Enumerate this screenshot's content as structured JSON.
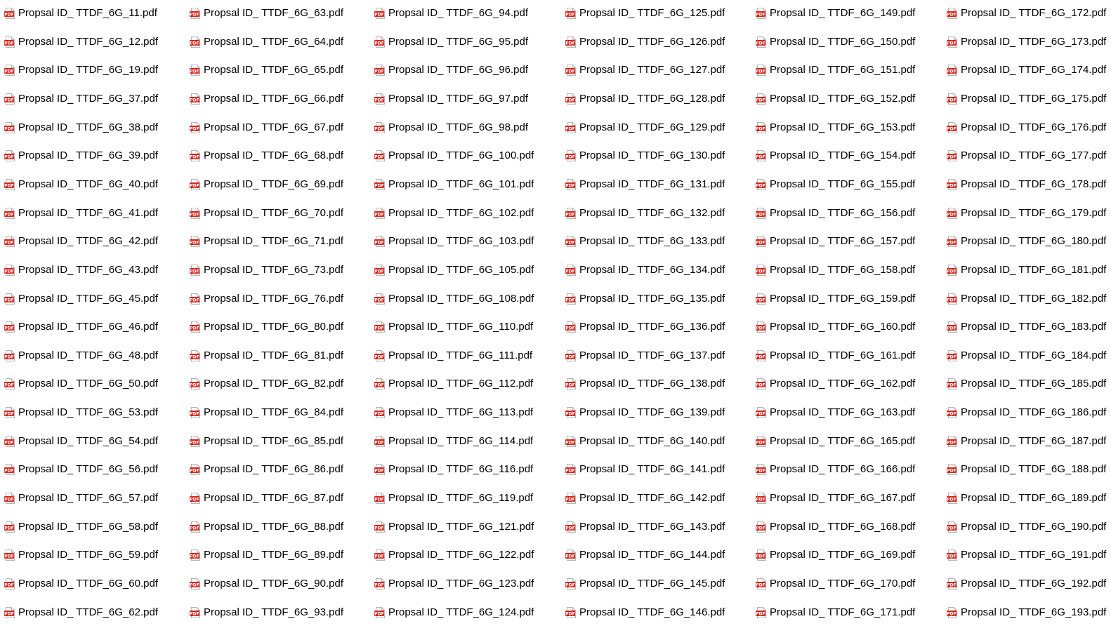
{
  "icon": "pdf-file-icon",
  "icon_colors": {
    "badge": "#d9261c",
    "page": "#ffffff",
    "border": "#b5b5b5"
  },
  "icon_badge_text": "PDF",
  "columns": [
    {
      "files": [
        "Propsal ID_ TTDF_6G_11.pdf",
        "Propsal ID_ TTDF_6G_12.pdf",
        "Propsal ID_ TTDF_6G_19.pdf",
        "Propsal ID_ TTDF_6G_37.pdf",
        "Propsal ID_ TTDF_6G_38.pdf",
        "Propsal ID_ TTDF_6G_39.pdf",
        "Propsal ID_ TTDF_6G_40.pdf",
        "Propsal ID_ TTDF_6G_41.pdf",
        "Propsal ID_ TTDF_6G_42.pdf",
        "Propsal ID_ TTDF_6G_43.pdf",
        "Propsal ID_ TTDF_6G_45.pdf",
        "Propsal ID_ TTDF_6G_46.pdf",
        "Propsal ID_ TTDF_6G_48.pdf",
        "Propsal ID_ TTDF_6G_50.pdf",
        "Propsal ID_ TTDF_6G_53.pdf",
        "Propsal ID_ TTDF_6G_54.pdf",
        "Propsal ID_ TTDF_6G_56.pdf",
        "Propsal ID_ TTDF_6G_57.pdf",
        "Propsal ID_ TTDF_6G_58.pdf",
        "Propsal ID_ TTDF_6G_59.pdf",
        "Propsal ID_ TTDF_6G_60.pdf",
        "Propsal ID_ TTDF_6G_62.pdf"
      ]
    },
    {
      "files": [
        "Propsal ID_ TTDF_6G_63.pdf",
        "Propsal ID_ TTDF_6G_64.pdf",
        "Propsal ID_ TTDF_6G_65.pdf",
        "Propsal ID_ TTDF_6G_66.pdf",
        "Propsal ID_ TTDF_6G_67.pdf",
        "Propsal ID_ TTDF_6G_68.pdf",
        "Propsal ID_ TTDF_6G_69.pdf",
        "Propsal ID_ TTDF_6G_70.pdf",
        "Propsal ID_ TTDF_6G_71.pdf",
        "Propsal ID_ TTDF_6G_73.pdf",
        "Propsal ID_ TTDF_6G_76.pdf",
        "Propsal ID_ TTDF_6G_80.pdf",
        "Propsal ID_ TTDF_6G_81.pdf",
        "Propsal ID_ TTDF_6G_82.pdf",
        "Propsal ID_ TTDF_6G_84.pdf",
        "Propsal ID_ TTDF_6G_85.pdf",
        "Propsal ID_ TTDF_6G_86.pdf",
        "Propsal ID_ TTDF_6G_87.pdf",
        "Propsal ID_ TTDF_6G_88.pdf",
        "Propsal ID_ TTDF_6G_89.pdf",
        "Propsal ID_ TTDF_6G_90.pdf",
        "Propsal ID_ TTDF_6G_93.pdf"
      ]
    },
    {
      "files": [
        "Propsal ID_ TTDF_6G_94.pdf",
        "Propsal ID_ TTDF_6G_95.pdf",
        "Propsal ID_ TTDF_6G_96.pdf",
        "Propsal ID_ TTDF_6G_97.pdf",
        "Propsal ID_ TTDF_6G_98.pdf",
        "Propsal ID_ TTDF_6G_100.pdf",
        "Propsal ID_ TTDF_6G_101.pdf",
        "Propsal ID_ TTDF_6G_102.pdf",
        "Propsal ID_ TTDF_6G_103.pdf",
        "Propsal ID_ TTDF_6G_105.pdf",
        "Propsal ID_ TTDF_6G_108.pdf",
        "Propsal ID_ TTDF_6G_110.pdf",
        "Propsal ID_ TTDF_6G_111.pdf",
        "Propsal ID_ TTDF_6G_112.pdf",
        "Propsal ID_ TTDF_6G_113.pdf",
        "Propsal ID_ TTDF_6G_114.pdf",
        "Propsal ID_ TTDF_6G_116.pdf",
        "Propsal ID_ TTDF_6G_119.pdf",
        "Propsal ID_ TTDF_6G_121.pdf",
        "Propsal ID_ TTDF_6G_122.pdf",
        "Propsal ID_ TTDF_6G_123.pdf",
        "Propsal ID_ TTDF_6G_124.pdf"
      ]
    },
    {
      "files": [
        "Propsal ID_ TTDF_6G_125.pdf",
        "Propsal ID_ TTDF_6G_126.pdf",
        "Propsal ID_ TTDF_6G_127.pdf",
        "Propsal ID_ TTDF_6G_128.pdf",
        "Propsal ID_ TTDF_6G_129.pdf",
        "Propsal ID_ TTDF_6G_130.pdf",
        "Propsal ID_ TTDF_6G_131.pdf",
        "Propsal ID_ TTDF_6G_132.pdf",
        "Propsal ID_ TTDF_6G_133.pdf",
        "Propsal ID_ TTDF_6G_134.pdf",
        "Propsal ID_ TTDF_6G_135.pdf",
        "Propsal ID_ TTDF_6G_136.pdf",
        "Propsal ID_ TTDF_6G_137.pdf",
        "Propsal ID_ TTDF_6G_138.pdf",
        "Propsal ID_ TTDF_6G_139.pdf",
        "Propsal ID_ TTDF_6G_140.pdf",
        "Propsal ID_ TTDF_6G_141.pdf",
        "Propsal ID_ TTDF_6G_142.pdf",
        "Propsal ID_ TTDF_6G_143.pdf",
        "Propsal ID_ TTDF_6G_144.pdf",
        "Propsal ID_ TTDF_6G_145.pdf",
        "Propsal ID_ TTDF_6G_146.pdf"
      ]
    },
    {
      "files": [
        "Propsal ID_ TTDF_6G_149.pdf",
        "Propsal ID_ TTDF_6G_150.pdf",
        "Propsal ID_ TTDF_6G_151.pdf",
        "Propsal ID_ TTDF_6G_152.pdf",
        "Propsal ID_ TTDF_6G_153.pdf",
        "Propsal ID_ TTDF_6G_154.pdf",
        "Propsal ID_ TTDF_6G_155.pdf",
        "Propsal ID_ TTDF_6G_156.pdf",
        "Propsal ID_ TTDF_6G_157.pdf",
        "Propsal ID_ TTDF_6G_158.pdf",
        "Propsal ID_ TTDF_6G_159.pdf",
        "Propsal ID_ TTDF_6G_160.pdf",
        "Propsal ID_ TTDF_6G_161.pdf",
        "Propsal ID_ TTDF_6G_162.pdf",
        "Propsal ID_ TTDF_6G_163.pdf",
        "Propsal ID_ TTDF_6G_165.pdf",
        "Propsal ID_ TTDF_6G_166.pdf",
        "Propsal ID_ TTDF_6G_167.pdf",
        "Propsal ID_ TTDF_6G_168.pdf",
        "Propsal ID_ TTDF_6G_169.pdf",
        "Propsal ID_ TTDF_6G_170.pdf",
        "Propsal ID_ TTDF_6G_171.pdf"
      ]
    },
    {
      "files": [
        "Propsal ID_ TTDF_6G_172.pdf",
        "Propsal ID_ TTDF_6G_173.pdf",
        "Propsal ID_ TTDF_6G_174.pdf",
        "Propsal ID_ TTDF_6G_175.pdf",
        "Propsal ID_ TTDF_6G_176.pdf",
        "Propsal ID_ TTDF_6G_177.pdf",
        "Propsal ID_ TTDF_6G_178.pdf",
        "Propsal ID_ TTDF_6G_179.pdf",
        "Propsal ID_ TTDF_6G_180.pdf",
        "Propsal ID_ TTDF_6G_181.pdf",
        "Propsal ID_ TTDF_6G_182.pdf",
        "Propsal ID_ TTDF_6G_183.pdf",
        "Propsal ID_ TTDF_6G_184.pdf",
        "Propsal ID_ TTDF_6G_185.pdf",
        "Propsal ID_ TTDF_6G_186.pdf",
        "Propsal ID_ TTDF_6G_187.pdf",
        "Propsal ID_ TTDF_6G_188.pdf",
        "Propsal ID_ TTDF_6G_189.pdf",
        "Propsal ID_ TTDF_6G_190.pdf",
        "Propsal ID_ TTDF_6G_191.pdf",
        "Propsal ID_ TTDF_6G_192.pdf",
        "Propsal ID_ TTDF_6G_193.pdf"
      ]
    }
  ]
}
